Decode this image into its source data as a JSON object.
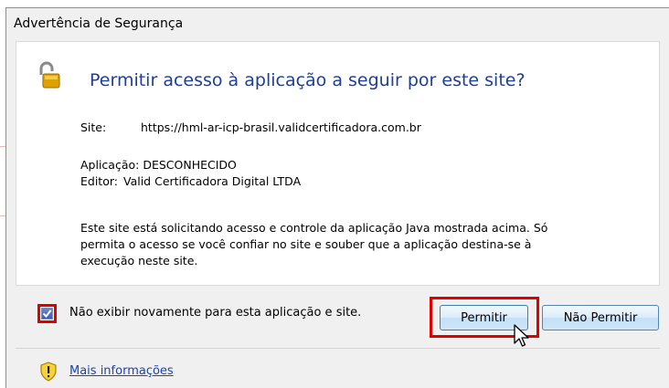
{
  "dialog": {
    "title": "Advertência de Segurança",
    "headline": "Permitir acesso à aplicação a seguir por este site?",
    "site_label": "Site:",
    "site_value": "https://hml-ar-icp-brasil.validcertificadora.com.br",
    "application_line": "Aplicação: DESCONHECIDO",
    "editor_label": "Editor:",
    "editor_value": "Valid Certificadora Digital LTDA",
    "description_lines": [
      "Este site está solicitando acesso e controle da aplicação Java mostrada acima. Só",
      "permita o acesso se você confiar no site e souber que a aplicação destina-se à",
      "execução neste site."
    ],
    "checkbox_label": "Não exibir novamente para esta aplicação e site.",
    "checkbox_checked": true,
    "permit_button": "Permitir",
    "deny_button": "Não Permitir",
    "more_info_link": "Mais informações"
  },
  "colors": {
    "headline": "#1e3f98",
    "highlight": "#e00000",
    "link": "#1a44b8"
  },
  "icons": [
    "unlocked-padlock-icon",
    "checkmark-icon",
    "mouse-cursor-icon",
    "warning-shield-icon"
  ]
}
